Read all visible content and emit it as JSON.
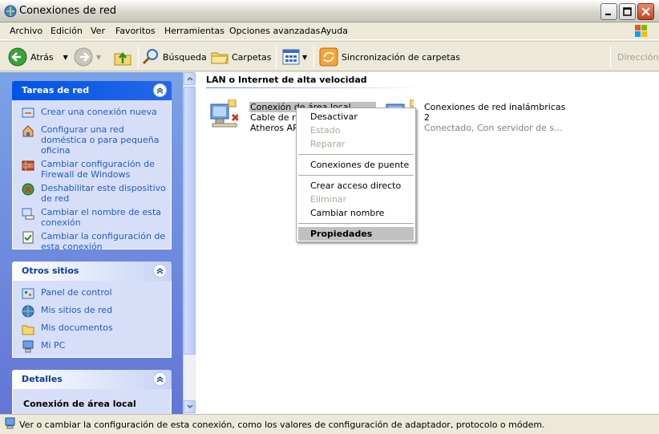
{
  "window": {
    "title": "Conexiones de red"
  },
  "menu": [
    "Archivo",
    "Edición",
    "Ver",
    "Favoritos",
    "Herramientas",
    "Opciones avanzadas",
    "Ayuda"
  ],
  "toolbar": {
    "back_label": "Atrás",
    "search_label": "Búsqueda",
    "folders_label": "Carpetas",
    "sync_label": "Sincronización de carpetas",
    "address_label": "Dirección"
  },
  "taskpane": {
    "network_tasks": {
      "title": "Tareas de red",
      "items": [
        {
          "label": "Crear una conexión nueva",
          "icon": "new-connection-icon"
        },
        {
          "label": "Configurar una red doméstica o para pequeña oficina",
          "icon": "home-network-icon"
        },
        {
          "label": "Cambiar configuración de Firewall de Windows",
          "icon": "firewall-icon"
        },
        {
          "label": "Deshabilitar este dispositivo de red",
          "icon": "disable-device-icon"
        },
        {
          "label": "Cambiar el nombre de esta conexión",
          "icon": "rename-icon"
        },
        {
          "label": "Cambiar la configuración de esta conexión",
          "icon": "settings-icon"
        }
      ]
    },
    "other_places": {
      "title": "Otros sitios",
      "items": [
        {
          "label": "Panel de control",
          "icon": "control-panel-icon"
        },
        {
          "label": "Mis sitios de red",
          "icon": "network-places-icon"
        },
        {
          "label": "Mis documentos",
          "icon": "my-documents-icon"
        },
        {
          "label": "Mi PC",
          "icon": "my-computer-icon"
        }
      ]
    },
    "details": {
      "title": "Detalles",
      "subtitle": "Conexión de área local"
    }
  },
  "content": {
    "group_title": "LAN o Internet de alta velocidad",
    "connections": [
      {
        "name": "Conexión de área local",
        "status": "Cable de re",
        "device": "Atheros AR"
      },
      {
        "name": "Conexiones de red inalámbricas",
        "status": "2",
        "device": "Conectado, Con servidor de s..."
      }
    ]
  },
  "context_menu": {
    "items": [
      {
        "label": "Desactivar",
        "enabled": true
      },
      {
        "label": "Estado",
        "enabled": false
      },
      {
        "label": "Reparar",
        "enabled": false
      },
      {
        "label": "Conexiones de puente",
        "enabled": true
      },
      {
        "label": "Crear acceso directo",
        "enabled": true
      },
      {
        "label": "Eliminar",
        "enabled": false
      },
      {
        "label": "Cambiar nombre",
        "enabled": true
      },
      {
        "label": "Propiedades",
        "enabled": true,
        "highlighted": true
      }
    ]
  },
  "statusbar": {
    "text": "Ver o cambiar la configuración de esta conexión, como los valores de configuración de adaptador, protocolo o módem."
  }
}
